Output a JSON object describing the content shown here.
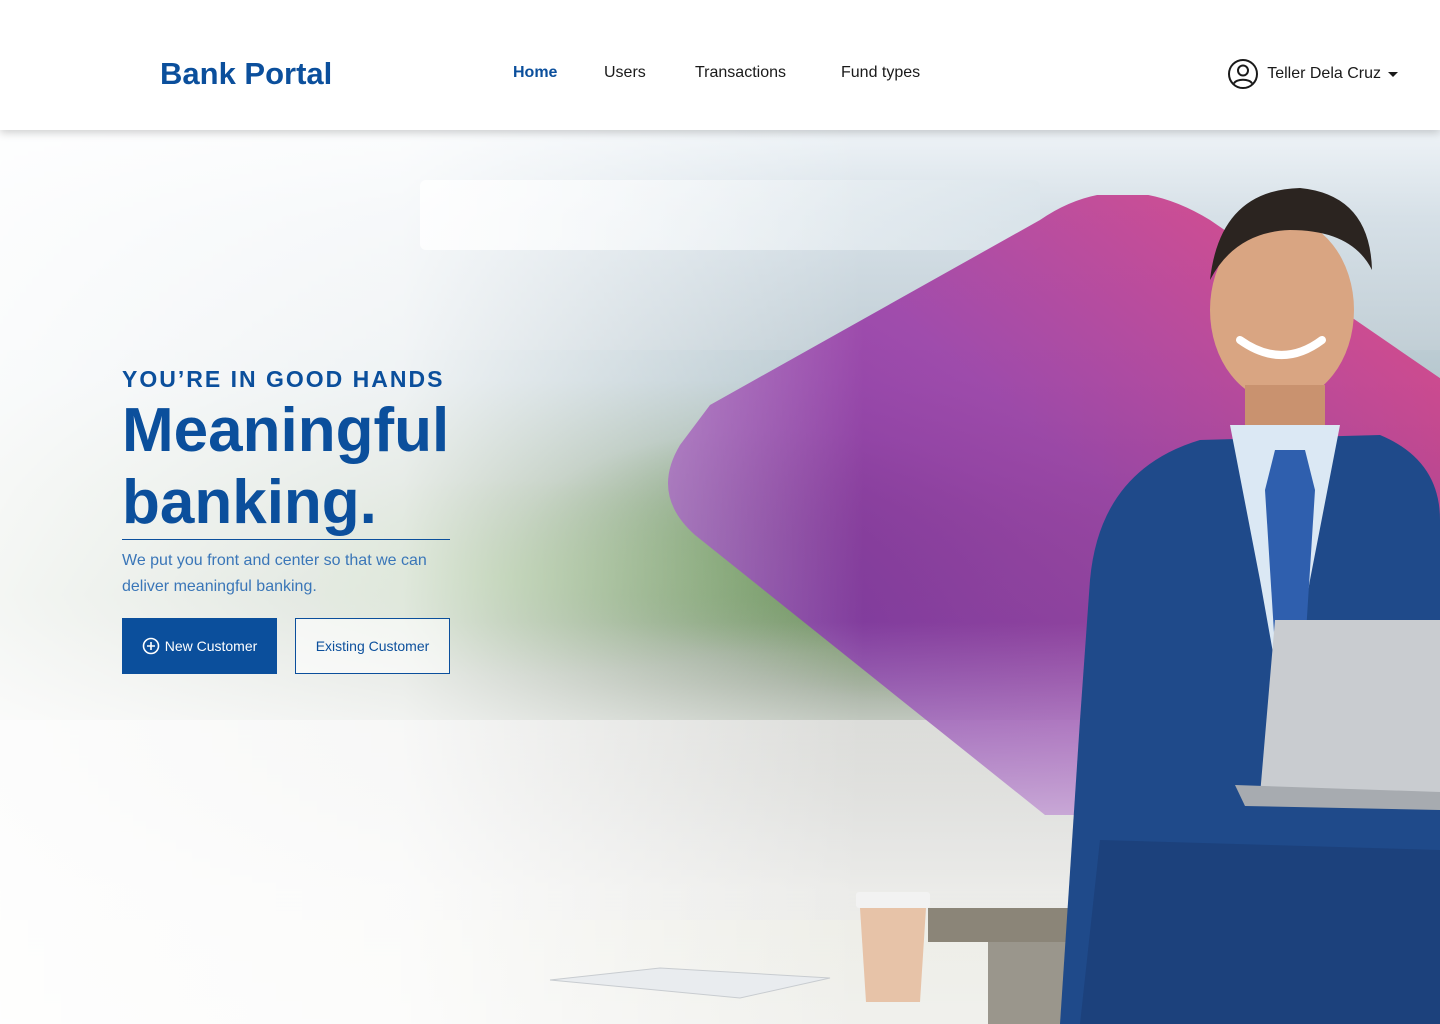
{
  "brand": {
    "name": "Bank Portal"
  },
  "nav": {
    "items": [
      {
        "label": "Home",
        "active": true
      },
      {
        "label": "Users",
        "active": false
      },
      {
        "label": "Transactions",
        "active": false
      },
      {
        "label": "Fund types",
        "active": false
      }
    ]
  },
  "user": {
    "name": "Teller Dela Cruz",
    "icon": "user-circle-icon"
  },
  "hero": {
    "eyebrow": "YOU’RE IN GOOD HANDS",
    "headline_line1": "Meaningful",
    "headline_line2": "banking.",
    "subtext": "We put you front and center so that we can deliver meaningful banking.",
    "primary_button": "New Customer",
    "primary_button_icon": "plus-circle-icon",
    "secondary_button": "Existing Customer"
  },
  "colors": {
    "brand": "#0b4f9c",
    "subtext": "#3a76b8",
    "diamond_start": "#7b2fa8",
    "diamond_end": "#e0407a"
  }
}
